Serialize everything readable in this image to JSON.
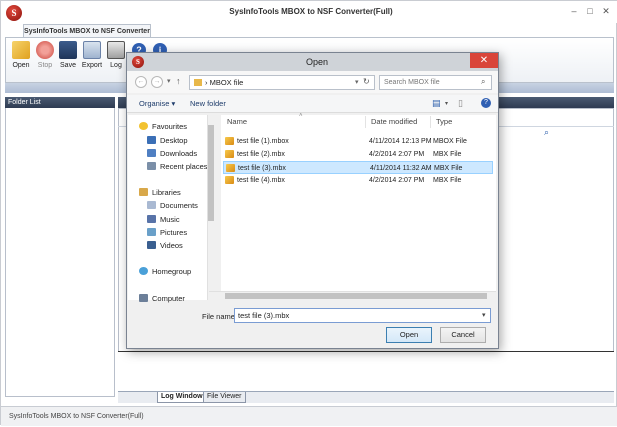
{
  "app": {
    "title": "SysInfoTools MBOX to NSF Converter(Full)",
    "logo_letter": "S",
    "ribbon_tab": "SysInfoTools MBOX to NSF Converter",
    "ribbon_caption": "SysInfoTools MBOX to NSF Converter",
    "window_buttons": [
      "–",
      "□",
      "✕"
    ]
  },
  "toolbar": {
    "items": [
      {
        "label": "Open",
        "icon": "open-folder-icon"
      },
      {
        "label": "Stop",
        "icon": "stop-icon"
      },
      {
        "label": "Save",
        "icon": "save-icon"
      },
      {
        "label": "Export",
        "icon": "export-icon"
      },
      {
        "label": "Log",
        "icon": "log-icon"
      }
    ],
    "help_icons": [
      "?",
      "i"
    ]
  },
  "left_pane": {
    "header": "Folder List"
  },
  "bottom_tabs": [
    "Log Window",
    "File Viewer"
  ],
  "status_bar": "SysInfoTools MBOX to NSF Converter(Full)",
  "dialog": {
    "title": "Open",
    "close": "✕",
    "address": {
      "path_sep": "›",
      "folder": "MBOX file"
    },
    "search_placeholder": "Search MBOX file",
    "organise": "Organise ▾",
    "new_folder": "New folder",
    "nav_items": [
      {
        "label": "Favourites",
        "icon": "star-icon"
      },
      {
        "label": "Desktop",
        "icon": "desktop-icon"
      },
      {
        "label": "Downloads",
        "icon": "downloads-icon"
      },
      {
        "label": "Recent places",
        "icon": "recent-places-icon"
      },
      {
        "label": "Libraries",
        "icon": "libraries-icon"
      },
      {
        "label": "Documents",
        "icon": "documents-icon"
      },
      {
        "label": "Music",
        "icon": "music-icon"
      },
      {
        "label": "Pictures",
        "icon": "pictures-icon"
      },
      {
        "label": "Videos",
        "icon": "videos-icon"
      },
      {
        "label": "Homegroup",
        "icon": "homegroup-icon"
      },
      {
        "label": "Computer",
        "icon": "computer-icon"
      }
    ],
    "columns": [
      "Name",
      "Date modified",
      "Type"
    ],
    "files": [
      {
        "name": "test file (1).mbox",
        "date": "4/11/2014 12:13 PM",
        "type": "MBOX File",
        "selected": false
      },
      {
        "name": "test file (2).mbx",
        "date": "4/2/2014 2:07 PM",
        "type": "MBX File",
        "selected": false
      },
      {
        "name": "test file (3).mbx",
        "date": "4/11/2014 11:32 AM",
        "type": "MBX File",
        "selected": true
      },
      {
        "name": "test file (4).mbx",
        "date": "4/2/2014 2:07 PM",
        "type": "MBX File",
        "selected": false
      }
    ],
    "file_name_label": "File name:",
    "file_name_value": "test file (3).mbx",
    "open_label": "Open",
    "cancel_label": "Cancel"
  }
}
